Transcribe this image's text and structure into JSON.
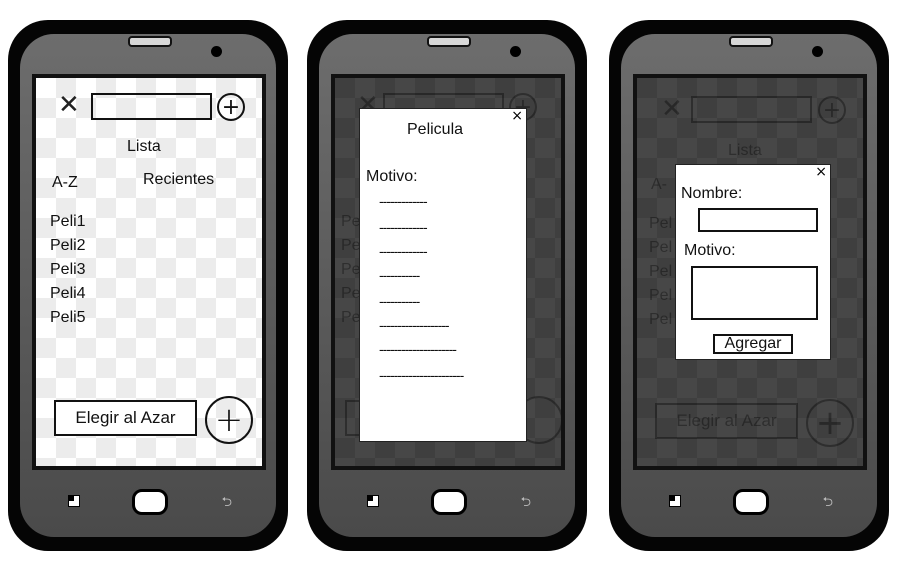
{
  "screens": {
    "list": {
      "title": "Lista",
      "sort_az": "A-Z",
      "sort_recent": "Recientes",
      "items": [
        "Peli1",
        "Peli2",
        "Peli3",
        "Peli4",
        "Peli5"
      ],
      "random_button": "Elegir al Azar"
    },
    "detail": {
      "modal_title": "Pelicula",
      "motive_label": "Motivo:",
      "close_label": "×",
      "lines": [
        "-------------",
        "-------------",
        "-------------",
        "-----------",
        "-----------",
        "-------------------",
        "---------------------",
        "-----------------------"
      ]
    },
    "add": {
      "name_label": "Nombre:",
      "motive_label": "Motivo:",
      "submit_button": "Agregar",
      "close_label": "×"
    }
  },
  "background_partial": {
    "title": "Lista",
    "random_button": "Elegir al Azar",
    "peek_a": "A-",
    "peek_pe": "Pe",
    "peek_pel": "Pel"
  }
}
